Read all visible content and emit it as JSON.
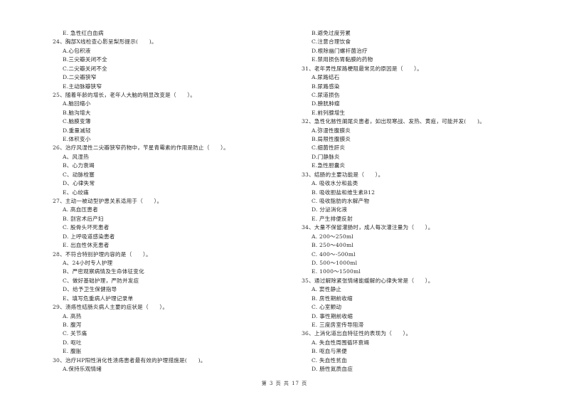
{
  "page": {
    "footer": "第 3 页 共 17 页"
  },
  "left_column": [
    {
      "type": "opt",
      "text": "E. 急性红白血病"
    },
    {
      "type": "q",
      "text": "24、胸部X线检查心影呈梨形提示(　　)。"
    },
    {
      "type": "opt",
      "text": "A.心包积液"
    },
    {
      "type": "opt",
      "text": "B.三尖瓣关闭不全"
    },
    {
      "type": "opt",
      "text": "C.二尖瓣关闭不全"
    },
    {
      "type": "opt",
      "text": "D.二尖瓣狭窄"
    },
    {
      "type": "opt",
      "text": "E.主动脉瓣狭窄"
    },
    {
      "type": "q",
      "text": "25、随着年龄的增长，老年人大脑的明显改变是（　　）。"
    },
    {
      "type": "opt",
      "text": "A.脑回缩小"
    },
    {
      "type": "opt",
      "text": "B.脑沟增大"
    },
    {
      "type": "opt",
      "text": "C.脑膜变薄"
    },
    {
      "type": "opt",
      "text": "D.重量减轻"
    },
    {
      "type": "opt",
      "text": "E.体积变小"
    },
    {
      "type": "q",
      "text": "26、治疗风湿性二尖瓣狭窄药物中，苄星青霉素的作用是防止（　　）。"
    },
    {
      "type": "opt",
      "text": "A、风湿热"
    },
    {
      "type": "opt",
      "text": "B、心力衰竭"
    },
    {
      "type": "opt",
      "text": "C、动脉栓塞"
    },
    {
      "type": "opt",
      "text": "D、心律失常"
    },
    {
      "type": "opt",
      "text": "E、心绞痛"
    },
    {
      "type": "q",
      "text": "27、主动一被动型护患关系适用于（　　）。"
    },
    {
      "type": "opt",
      "text": "A. 高血压患者"
    },
    {
      "type": "opt",
      "text": "B. 剖宫术后产妇"
    },
    {
      "type": "opt",
      "text": "C. 股骨头坏死患者"
    },
    {
      "type": "opt",
      "text": "D. 上呼吸道感染患者"
    },
    {
      "type": "opt",
      "text": "E. 出血性休克患者"
    },
    {
      "type": "q",
      "text": "28、不符合特别护理内容的是（　　）。"
    },
    {
      "type": "opt",
      "text": "A、24小时专人护理"
    },
    {
      "type": "opt",
      "text": "B、严密观察病情及生命体征变化"
    },
    {
      "type": "opt",
      "text": "C、做好基础护理，严防并发症"
    },
    {
      "type": "opt",
      "text": "D、给予卫生保健指导"
    },
    {
      "type": "opt",
      "text": "E、填写危重病人护理记录单"
    },
    {
      "type": "q",
      "text": "29、溃疡性结肠炎病人主要的症状是（　　）。"
    },
    {
      "type": "opt",
      "text": "A. 高热"
    },
    {
      "type": "opt",
      "text": "B. 腹泻"
    },
    {
      "type": "opt",
      "text": "C. 关节痛"
    },
    {
      "type": "opt",
      "text": "D. 呕吐"
    },
    {
      "type": "opt",
      "text": "E. 腹胀"
    },
    {
      "type": "q",
      "text": "30、治疗HP阳性消化性溃疡患者最有效的护理措施是(　　)。"
    },
    {
      "type": "opt",
      "text": "A.保持乐观情绪"
    }
  ],
  "right_column": [
    {
      "type": "opt",
      "text": "B.避免过度劳累"
    },
    {
      "type": "opt",
      "text": "C.注意合理饮食"
    },
    {
      "type": "opt",
      "text": "D.根除幽门螺杆菌治疗"
    },
    {
      "type": "opt",
      "text": "E.禁用损伤胃黏膜的药物"
    },
    {
      "type": "q",
      "text": "31、老年男性尿路梗阻最常见的原因是（　　）。"
    },
    {
      "type": "opt",
      "text": "A.尿路结石"
    },
    {
      "type": "opt",
      "text": "B.尿路感染"
    },
    {
      "type": "opt",
      "text": "C.尿道损伤"
    },
    {
      "type": "opt",
      "text": "D.膀胱肿瘤"
    },
    {
      "type": "opt",
      "text": "E.前列腺增生"
    },
    {
      "type": "q",
      "text": "32、急性化脓性阑尾炎患者，如出现寒战、发热、黄疸，可能并发(　　)。"
    },
    {
      "type": "opt",
      "text": "A.弥漫性腹膜炎"
    },
    {
      "type": "opt",
      "text": "B.局限性腹膜炎"
    },
    {
      "type": "opt",
      "text": "C.细菌性肝炎"
    },
    {
      "type": "opt",
      "text": "D.门静脉炎"
    },
    {
      "type": "opt",
      "text": "E.急性胆囊炎"
    },
    {
      "type": "q",
      "text": "33、结肠的主要功能是（　　）。"
    },
    {
      "type": "opt",
      "text": "A. 吸收水分和盐类"
    },
    {
      "type": "opt",
      "text": "B. 吸收胆盐和维生素B12"
    },
    {
      "type": "opt",
      "text": "C. 吸收脂肪的水解产物"
    },
    {
      "type": "opt",
      "text": "D. 分泌消化液"
    },
    {
      "type": "opt",
      "text": "E. 产生排便反射"
    },
    {
      "type": "q",
      "text": "34、大量不保留灌肠时，成人每次灌注量为（　　）。"
    },
    {
      "type": "opt",
      "text": "A. 200～250ml"
    },
    {
      "type": "opt",
      "text": "B. 250～400ml"
    },
    {
      "type": "opt",
      "text": "C. 400～-500ml"
    },
    {
      "type": "opt",
      "text": "D. 500～1000ml"
    },
    {
      "type": "opt",
      "text": "E. 1000～1500ml"
    },
    {
      "type": "q",
      "text": "35、通过解除紧张情绪能缓解的心律失常是（　　）。"
    },
    {
      "type": "opt",
      "text": "A. 窦性静止"
    },
    {
      "type": "opt",
      "text": "B. 房性期前收缩"
    },
    {
      "type": "opt",
      "text": "C. 心室颤动"
    },
    {
      "type": "opt",
      "text": "D. 事性期前收缩"
    },
    {
      "type": "opt",
      "text": "E. 三度房室传导阻滞"
    },
    {
      "type": "q",
      "text": "36、上消化道出血特征性的表现为（　　）。"
    },
    {
      "type": "opt",
      "text": "A. 失血性周围循环衰竭"
    },
    {
      "type": "opt",
      "text": "B. 呕血与黑便"
    },
    {
      "type": "opt",
      "text": "C. 失血性贫血"
    },
    {
      "type": "opt",
      "text": "D. 肠性氮质血症"
    }
  ]
}
